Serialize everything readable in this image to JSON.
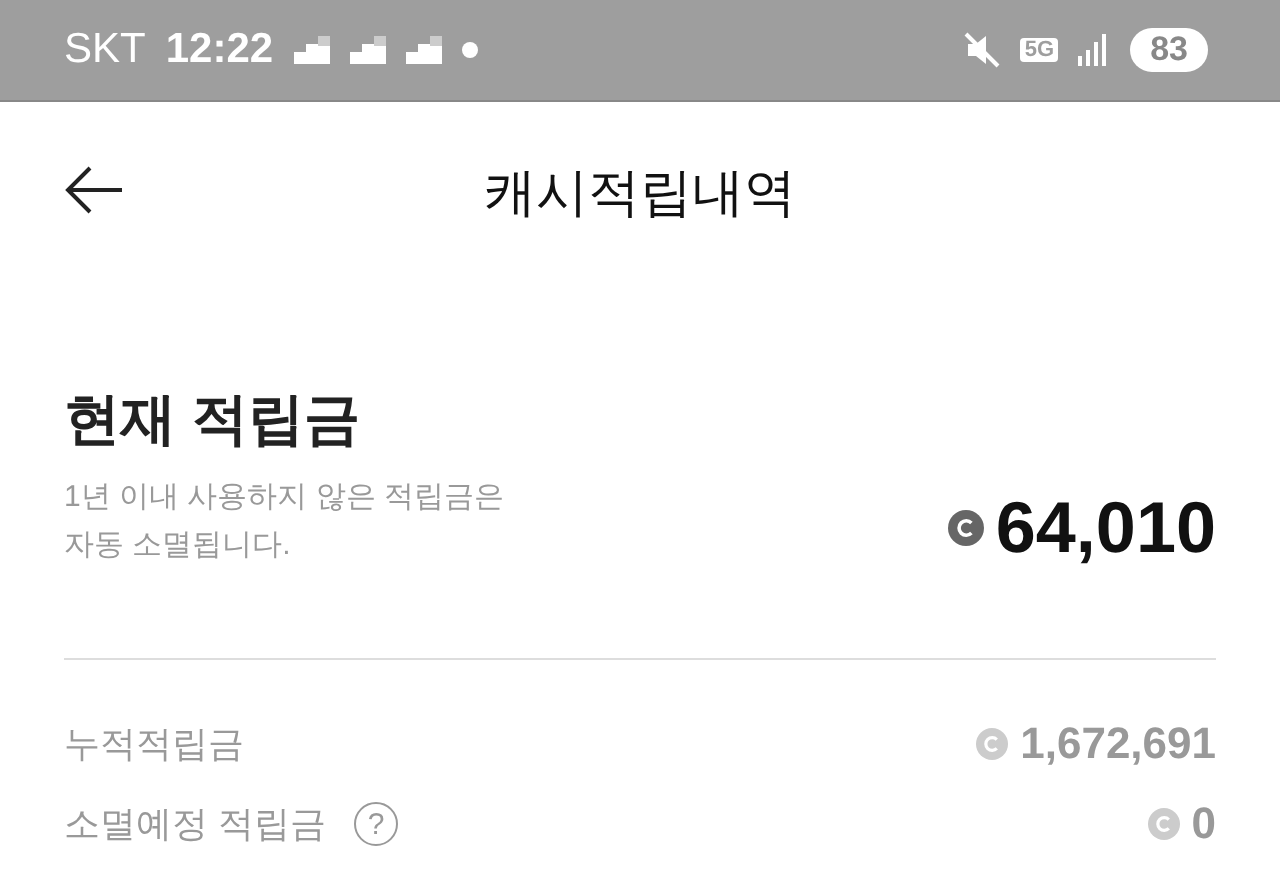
{
  "status_bar": {
    "carrier": "SKT",
    "time": "12:22",
    "network": "5G",
    "battery": "83"
  },
  "header": {
    "title": "캐시적립내역"
  },
  "current": {
    "title": "현재 적립금",
    "description": "1년 이내 사용하지 않은 적립금은\n자동 소멸됩니다.",
    "amount": "64,010"
  },
  "rows": [
    {
      "label": "누적적립금",
      "amount": "1,672,691"
    },
    {
      "label": "소멸예정 적립금",
      "help": "?",
      "amount": "0"
    }
  ]
}
